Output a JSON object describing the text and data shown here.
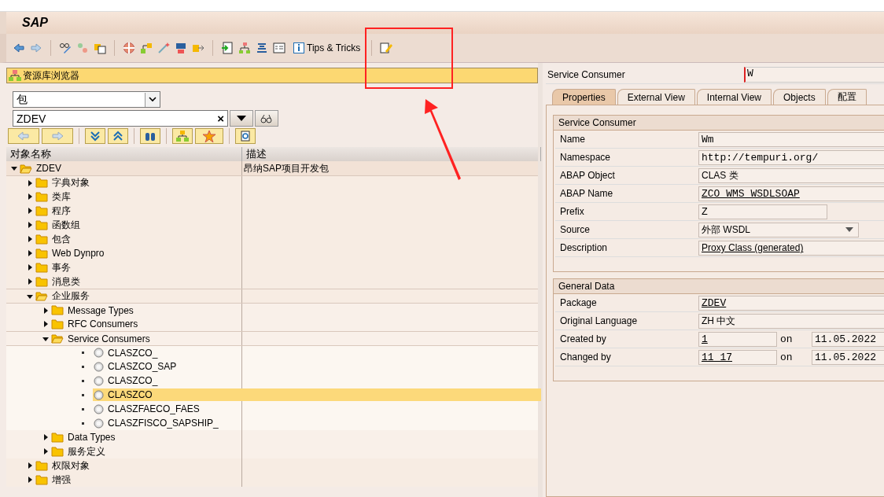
{
  "window": {
    "title": "SAP"
  },
  "toolbar": {
    "tips_button": "Tips & Tricks"
  },
  "browser": {
    "title": "资源库浏览器",
    "object_type": "包",
    "object_name": "ZDEV",
    "clear_symbol": "×"
  },
  "tree": {
    "columns": [
      "对象名称",
      "描述"
    ],
    "items": [
      {
        "kind": "folder",
        "label": "ZDEV",
        "description": "昂纳SAP项目开发包",
        "expanded": true,
        "selected": false,
        "children": [
          {
            "kind": "folder",
            "label": "字典对象",
            "expanded": false,
            "selected": false
          },
          {
            "kind": "folder",
            "label": "类库",
            "expanded": false,
            "selected": false
          },
          {
            "kind": "folder",
            "label": "程序",
            "expanded": false,
            "selected": false
          },
          {
            "kind": "folder",
            "label": "函数组",
            "expanded": false,
            "selected": false
          },
          {
            "kind": "folder",
            "label": "包含",
            "expanded": false,
            "selected": false
          },
          {
            "kind": "folder",
            "label": "Web Dynpro",
            "expanded": false,
            "selected": false
          },
          {
            "kind": "folder",
            "label": "事务",
            "expanded": false,
            "selected": false
          },
          {
            "kind": "folder",
            "label": "消息类",
            "expanded": false,
            "selected": false
          },
          {
            "kind": "folder",
            "label": "企业服务",
            "expanded": true,
            "selected": false,
            "children": [
              {
                "kind": "folder",
                "label": "Message Types",
                "expanded": false,
                "selected": false
              },
              {
                "kind": "folder",
                "label": "RFC Consumers",
                "expanded": false,
                "selected": false
              },
              {
                "kind": "folder",
                "label": "Service Consumers",
                "expanded": true,
                "selected": false,
                "children": [
                  {
                    "kind": "object",
                    "label": "CLASZCO_",
                    "selected": false
                  },
                  {
                    "kind": "object",
                    "label": "CLASZCO_SAP",
                    "selected": false
                  },
                  {
                    "kind": "object",
                    "label": "CLASZCO_",
                    "selected": false
                  },
                  {
                    "kind": "object",
                    "label": "CLASZCO",
                    "selected": true
                  },
                  {
                    "kind": "object",
                    "label": "CLASZFAECO_FAES",
                    "selected": false
                  },
                  {
                    "kind": "object",
                    "label": "CLASZFISCO_SAPSHIP_",
                    "selected": false
                  }
                ]
              },
              {
                "kind": "folder",
                "label": "Data Types",
                "expanded": false,
                "selected": false
              },
              {
                "kind": "folder",
                "label": "服务定义",
                "expanded": false,
                "selected": false
              }
            ]
          },
          {
            "kind": "folder",
            "label": "权限对象",
            "expanded": false,
            "selected": false
          },
          {
            "kind": "folder",
            "label": "增强",
            "expanded": false,
            "selected": false
          }
        ]
      }
    ]
  },
  "detail": {
    "header_label": "Service Consumer",
    "header_value": "W",
    "tabs": [
      {
        "label": "Properties",
        "selected": true
      },
      {
        "label": "External View",
        "selected": false
      },
      {
        "label": "Internal View",
        "selected": false
      },
      {
        "label": "Objects",
        "selected": false
      },
      {
        "label": "配置",
        "selected": false
      }
    ],
    "sections": [
      {
        "title": "Service Consumer",
        "fields": [
          {
            "label": "Name",
            "value": "Wm",
            "kind": "mono"
          },
          {
            "label": "Namespace",
            "value": "http://tempuri.org/",
            "kind": "mono"
          },
          {
            "label": "ABAP Object",
            "value": "CLAS 类",
            "kind": "text"
          },
          {
            "label": "ABAP Name",
            "value": "ZCO_WMS_WSDLSOAP",
            "kind": "link"
          },
          {
            "label": "Prefix",
            "value": "Z",
            "kind": "short"
          },
          {
            "label": "Source",
            "value": "外部 WSDL",
            "kind": "dropdown"
          },
          {
            "label": "Description",
            "value": "Proxy Class (generated)",
            "kind": "textlink"
          }
        ]
      },
      {
        "title": "General Data",
        "fields": [
          {
            "label": "Package",
            "value": "ZDEV",
            "kind": "link"
          },
          {
            "label": "Original Language",
            "value": "ZH 中文",
            "kind": "text"
          },
          {
            "label": "Created by",
            "value": "1",
            "kind": "dated",
            "on": "on",
            "date": "11.05.2022"
          },
          {
            "label": "Changed by",
            "value": "11 17",
            "kind": "dated",
            "on": "on",
            "date": "11.05.2022"
          }
        ]
      }
    ]
  }
}
